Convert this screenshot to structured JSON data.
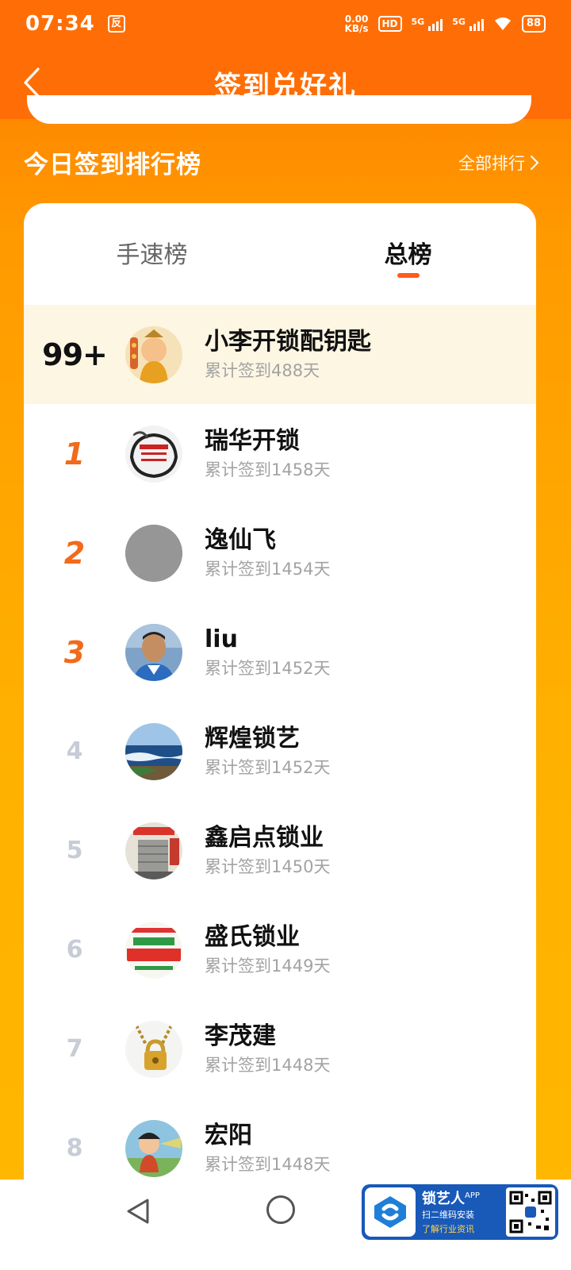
{
  "status": {
    "time": "07:34",
    "app_badge": "反",
    "net_speed_top": "0.00",
    "net_speed_bottom": "KB/s",
    "hd": "HD",
    "sig1_label": "5G",
    "sig2_label": "5G",
    "battery": "88"
  },
  "header": {
    "title": "签到兑好礼"
  },
  "section": {
    "title": "今日签到排行榜",
    "all_rank": "全部排行"
  },
  "tabs": [
    {
      "label": "手速榜",
      "active": false
    },
    {
      "label": "总榜",
      "active": true
    }
  ],
  "me_row": {
    "rank": "99+",
    "name": "小李开锁配钥匙",
    "days": "累计签到488天",
    "avatar": "cartoon-avatar"
  },
  "rows": [
    {
      "rank": "1",
      "name": "瑞华开锁",
      "days": "累计签到1458天",
      "avatar": "logo-avatar"
    },
    {
      "rank": "2",
      "name": "逸仙飞",
      "days": "累计签到1454天",
      "avatar": "gray-avatar"
    },
    {
      "rank": "3",
      "name": "liu",
      "days": "累计签到1452天",
      "avatar": "photo-avatar"
    },
    {
      "rank": "4",
      "name": "辉煌锁艺",
      "days": "累计签到1452天",
      "avatar": "sea-avatar"
    },
    {
      "rank": "5",
      "name": "鑫启点锁业",
      "days": "累计签到1450天",
      "avatar": "shop-avatar"
    },
    {
      "rank": "6",
      "name": "盛氏锁业",
      "days": "累计签到1449天",
      "avatar": "sign-avatar"
    },
    {
      "rank": "7",
      "name": "李茂建",
      "days": "累计签到1448天",
      "avatar": "lock-avatar"
    },
    {
      "rank": "8",
      "name": "宏阳",
      "days": "累计签到1448天",
      "avatar": "cartoon-kid-avatar"
    }
  ],
  "ad": {
    "name": "锁艺人",
    "sup": "APP",
    "line1": "扫二维码安装",
    "line2": "了解行业资讯"
  },
  "colors": {
    "accent": "#ff6e06",
    "rank_top": "#f26a1b",
    "tab_indicator": "#ff5c1b",
    "highlight_row": "#fdf6e3"
  }
}
